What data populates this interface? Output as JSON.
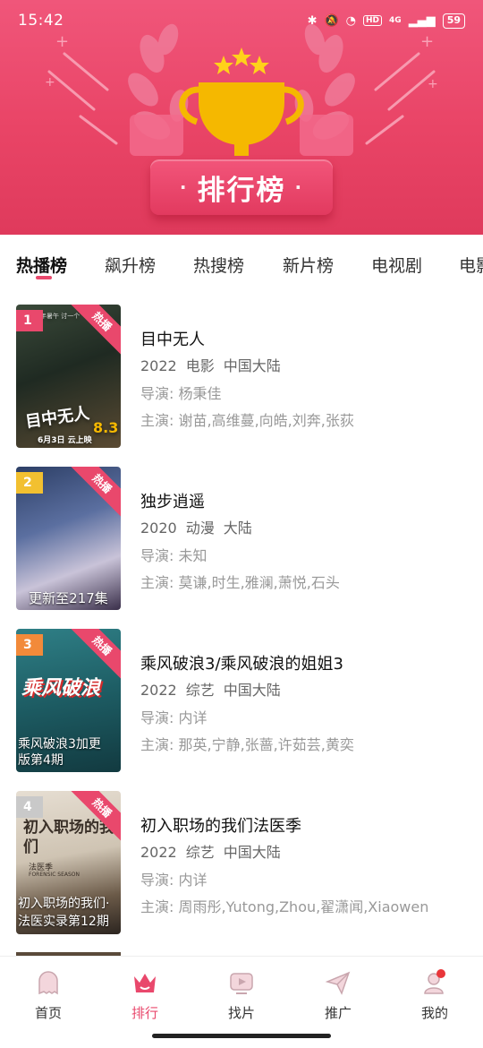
{
  "status_bar": {
    "time": "15:42",
    "network": "4G",
    "battery": "59"
  },
  "header": {
    "banner_title": "排行榜"
  },
  "tabs": [
    {
      "label": "热播榜",
      "active": true
    },
    {
      "label": "飙升榜",
      "active": false
    },
    {
      "label": "热搜榜",
      "active": false
    },
    {
      "label": "新片榜",
      "active": false
    },
    {
      "label": "电视剧",
      "active": false
    },
    {
      "label": "电影",
      "active": false
    }
  ],
  "items": [
    {
      "rank": "1",
      "corner_tag": "热播",
      "title": "目中无人",
      "year": "2022",
      "category": "电影",
      "region": "中国大陆",
      "director": "导演: 杨秉佳",
      "cast": "主演: 谢苗,高维蔓,向皓,刘奔,张荻",
      "poster_caption": "",
      "poster_art": "目中无人",
      "poster_score": "8.3",
      "poster_date": "6月3日 云上映",
      "poster_top": "今年暑午 讨一个"
    },
    {
      "rank": "2",
      "corner_tag": "热播",
      "title": "独步逍遥",
      "year": "2020",
      "category": "动漫",
      "region": "大陆",
      "director": "导演: 未知",
      "cast": "主演: 莫谦,时生,雅澜,萧悦,石头",
      "poster_caption": "更新至217集"
    },
    {
      "rank": "3",
      "corner_tag": "热播",
      "title": "乘风破浪3/乘风破浪的姐姐3",
      "year": "2022",
      "category": "综艺",
      "region": "中国大陆",
      "director": "导演: 内详",
      "cast": "主演: 那英,宁静,张蔷,许茹芸,黄奕",
      "poster_caption": "乘风破浪3加更版第4期",
      "poster_art": "乘风破浪"
    },
    {
      "rank": "4",
      "corner_tag": "热播",
      "title": "初入职场的我们法医季",
      "year": "2022",
      "category": "综艺",
      "region": "中国大陆",
      "director": "导演: 内详",
      "cast": "主演: 周雨彤,Yutong,Zhou,翟潇闻,Xiaowen",
      "poster_caption": "初入职场的我们·法医实录第12期",
      "poster_art": "初入职场的我们",
      "poster_sub": "法医季",
      "poster_en": "FORENSIC SEASON"
    }
  ],
  "bottom_nav": [
    {
      "label": "首页",
      "icon": "ghost-home-icon",
      "active": false
    },
    {
      "label": "排行",
      "icon": "crown-icon",
      "active": true
    },
    {
      "label": "找片",
      "icon": "tv-play-icon",
      "active": false
    },
    {
      "label": "推广",
      "icon": "paper-plane-icon",
      "active": false
    },
    {
      "label": "我的",
      "icon": "user-icon",
      "active": false
    }
  ],
  "colors": {
    "accent": "#e9486c",
    "header_bg": "#e94466",
    "trophy": "#f5b800"
  }
}
